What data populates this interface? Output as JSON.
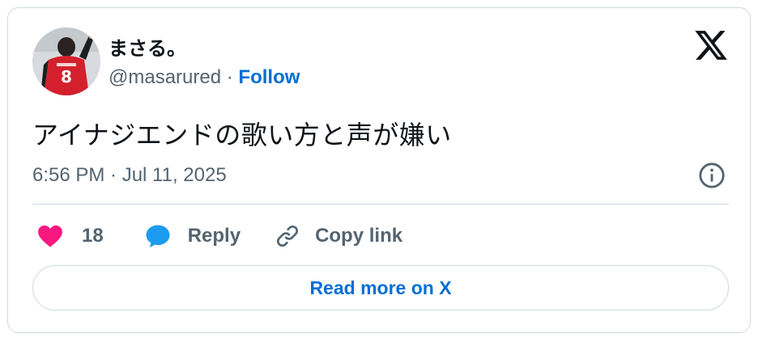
{
  "author": {
    "display_name": "まさる。",
    "handle": "@masarured",
    "separator": " · ",
    "follow_label": "Follow",
    "avatar_icon": "avatar-player-red-jersey-8"
  },
  "tweet": {
    "text": "アイナジエンドの歌い方と声が嫌い",
    "timestamp": "6:56 PM · Jul 11, 2025"
  },
  "actions": {
    "like_count": "18",
    "reply_label": "Reply",
    "copy_link_label": "Copy link"
  },
  "footer": {
    "read_more_label": "Read more on X"
  },
  "icons": {
    "brand": "x-logo-icon",
    "info": "info-icon",
    "like": "heart-icon",
    "reply": "reply-bubble-icon",
    "copy": "link-icon"
  },
  "colors": {
    "link": "#006fd6",
    "secondary_text": "#536471",
    "like_pink": "#f91880",
    "reply_blue": "#1d9bf0",
    "border": "#cfd9de"
  }
}
